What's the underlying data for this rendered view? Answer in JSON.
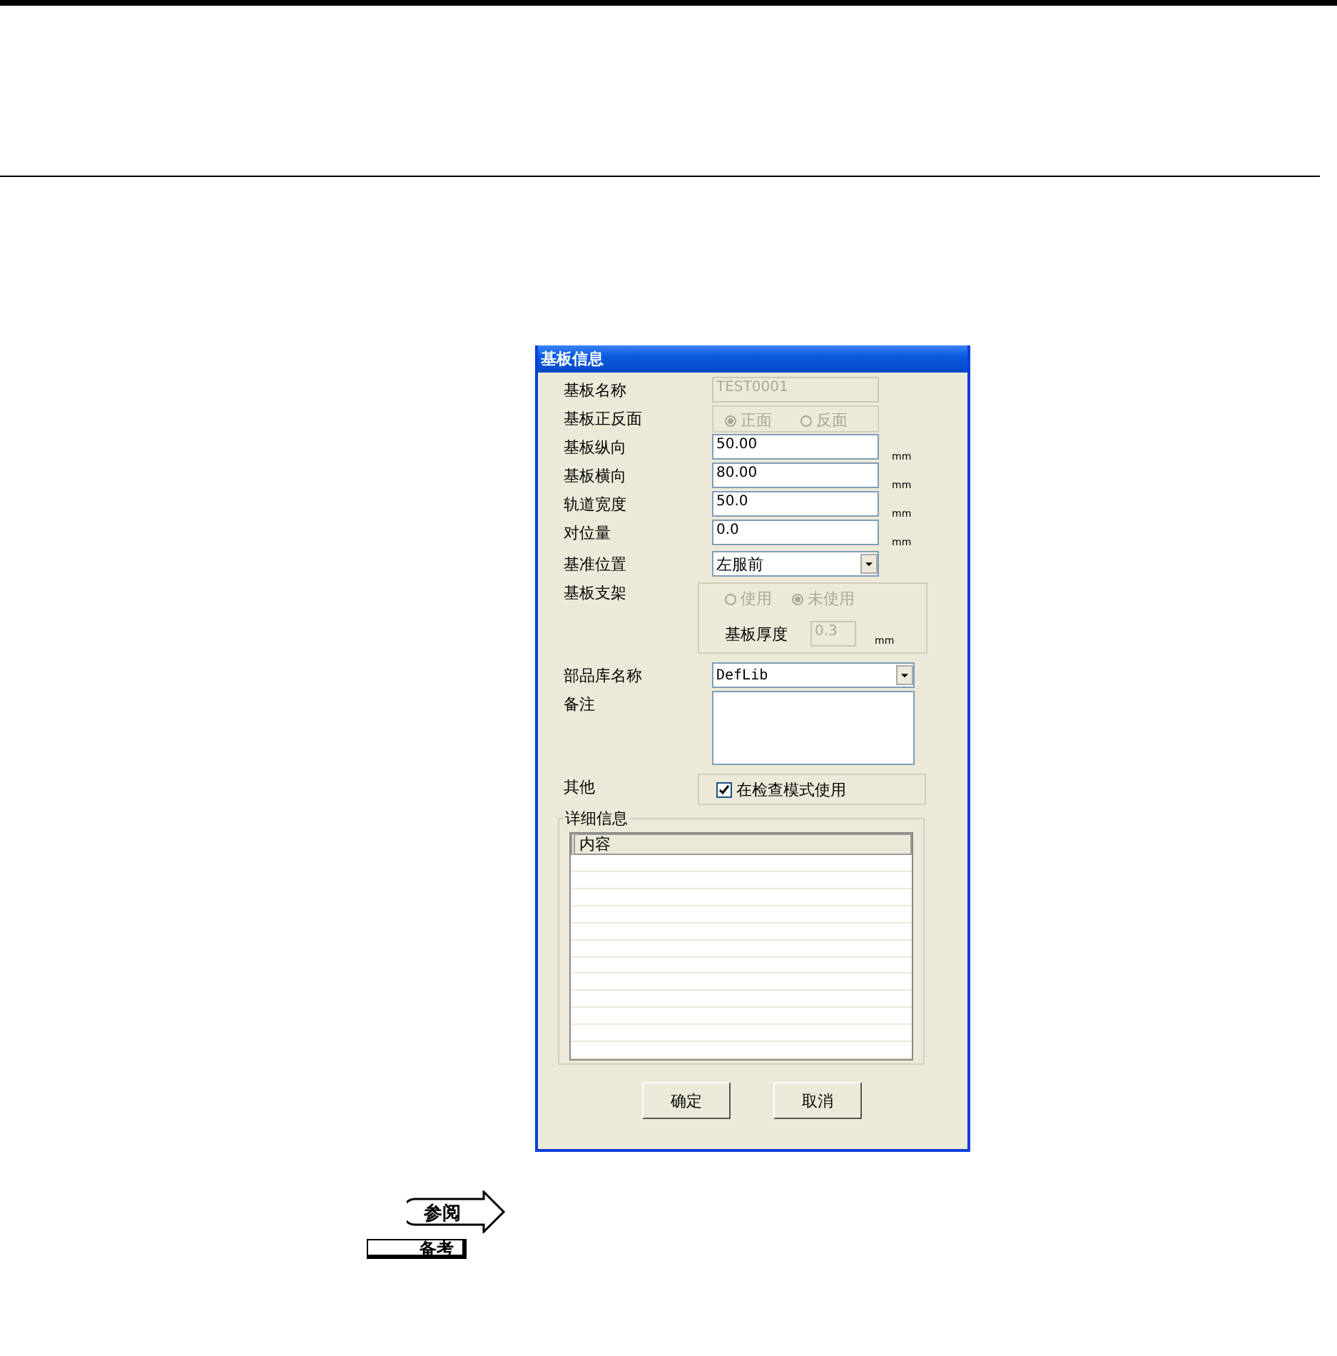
{
  "window": {
    "title": "基板信息"
  },
  "fields": [
    {
      "kind": "text",
      "label": "基板名称",
      "value": "TEST0001",
      "disabled": true
    },
    {
      "kind": "radio",
      "label": "基板正反面",
      "disabled": true,
      "options": [
        {
          "label": "正面",
          "selected": true
        },
        {
          "label": "反面",
          "selected": false
        }
      ]
    },
    {
      "kind": "text",
      "label": "基板纵向",
      "value": "50.00",
      "unit": "mm",
      "disabled": false
    },
    {
      "kind": "text",
      "label": "基板横向",
      "value": "80.00",
      "unit": "mm",
      "disabled": false
    },
    {
      "kind": "text",
      "label": "轨道宽度",
      "value": "50.0",
      "unit": "mm",
      "disabled": false
    },
    {
      "kind": "text",
      "label": "对位量",
      "value": "0.0",
      "unit": "mm",
      "disabled": false
    },
    {
      "kind": "dropdown",
      "label": "基准位置",
      "value": "左服前",
      "wide": false
    },
    {
      "kind": "support",
      "label": "基板支架",
      "disabled": true,
      "options": [
        {
          "label": "使用",
          "selected": false
        },
        {
          "label": "未使用",
          "selected": true
        }
      ],
      "thickness": {
        "label": "基板厚度",
        "value": "0.3",
        "unit": "mm"
      }
    },
    {
      "kind": "dropdown",
      "label": "部品库名称",
      "value": "DefLib",
      "wide": true
    },
    {
      "kind": "textarea",
      "label": "备注"
    },
    {
      "kind": "check",
      "label": "其他",
      "checkbox": {
        "label": "在检查模式使用",
        "checked": true
      }
    }
  ],
  "details": {
    "title": "详细信息",
    "columns": [
      "内容"
    ]
  },
  "buttons": [
    "确定",
    "取消"
  ],
  "page": {
    "reference_badge": "参阅",
    "note_badge": "备考"
  }
}
